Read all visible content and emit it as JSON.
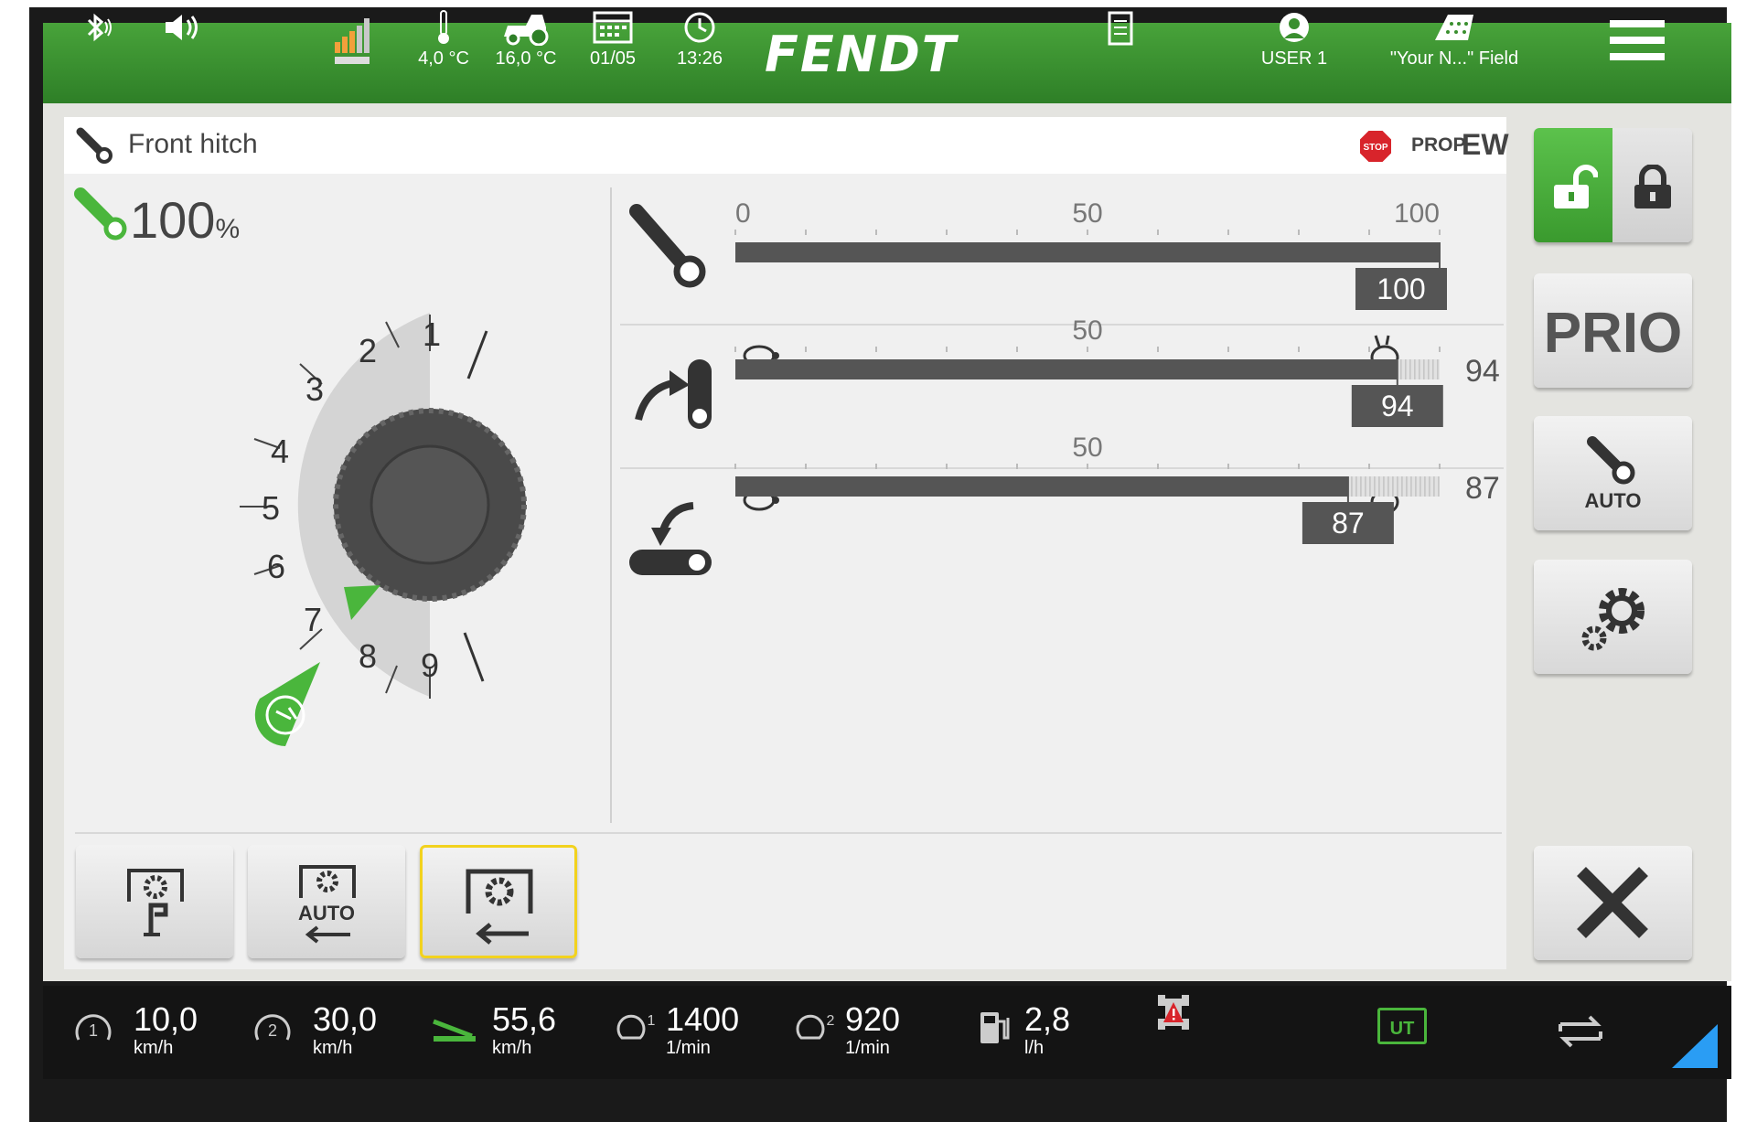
{
  "top_bar": {
    "outside_temp": "4,0 °C",
    "oil_temp": "16,0 °C",
    "date": "01/05",
    "time": "13:26",
    "logo": "FENDT",
    "user": "USER 1",
    "field": "\"Your N...\" Field"
  },
  "panel": {
    "title": "Front hitch",
    "stop_label": "STOP",
    "prop_label": "PROP",
    "ew_label": "EW",
    "position_value": "100",
    "position_unit": "%"
  },
  "dial": {
    "labels": [
      "1",
      "2",
      "3",
      "4",
      "5",
      "6",
      "7",
      "8",
      "9"
    ]
  },
  "sliders": [
    {
      "name": "position",
      "ticks": [
        "0",
        "50",
        "100"
      ],
      "value": 100,
      "value_label": "100",
      "percent": ""
    },
    {
      "name": "lift-speed",
      "ticks": [
        "",
        "50",
        ""
      ],
      "value": 94,
      "value_label": "94",
      "percent": "94"
    },
    {
      "name": "lower-speed",
      "ticks": [
        "",
        "50",
        ""
      ],
      "value": 87,
      "value_label": "87",
      "percent": "87"
    }
  ],
  "percent_unit": "%",
  "side_buttons": {
    "prio": "PRIO",
    "auto": "AUTO"
  },
  "bottom_buttons": {
    "auto": "AUTO"
  },
  "bottom_bar": {
    "speed1": {
      "value": "10,0",
      "unit": "km/h"
    },
    "speed2": {
      "value": "30,0",
      "unit": "km/h"
    },
    "speed_actual": {
      "value": "55,6",
      "unit": "km/h"
    },
    "rpm1": {
      "value": "1400",
      "unit": "1/min"
    },
    "rpm2": {
      "value": "920",
      "unit": "1/min"
    },
    "fuel": {
      "value": "2,8",
      "unit": "l/h"
    },
    "ut": "UT"
  },
  "colors": {
    "brand_green": "#3f9a32",
    "accent_green": "#4ab63c",
    "slider_dark": "#555555",
    "focus_yellow": "#f2d21e"
  }
}
